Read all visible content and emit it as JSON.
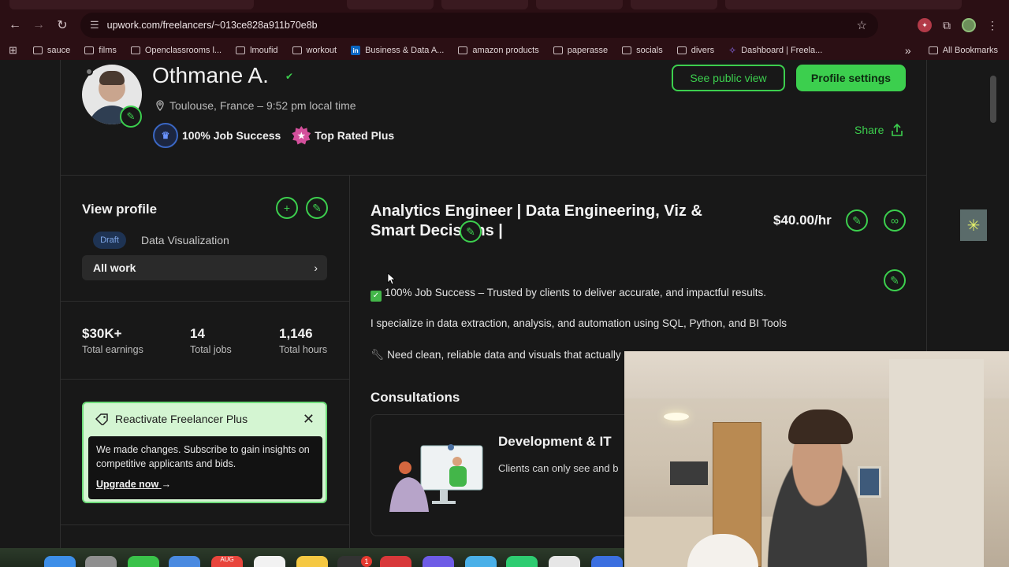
{
  "browser": {
    "url": "upwork.com/freelancers/~013ce828a911b70e8b",
    "bookmarks": [
      {
        "label": "sauce",
        "icon": "folder"
      },
      {
        "label": "films",
        "icon": "folder"
      },
      {
        "label": "Openclassrooms l...",
        "icon": "folder"
      },
      {
        "label": "lmoufid",
        "icon": "folder"
      },
      {
        "label": "workout",
        "icon": "folder"
      },
      {
        "label": "Business & Data A...",
        "icon": "linkedin"
      },
      {
        "label": "amazon products",
        "icon": "folder"
      },
      {
        "label": "paperasse",
        "icon": "folder"
      },
      {
        "label": "socials",
        "icon": "folder"
      },
      {
        "label": "divers",
        "icon": "folder"
      },
      {
        "label": "Dashboard | Freela...",
        "icon": "upwork"
      }
    ],
    "overflow_label": "»",
    "all_bookmarks_label": "All Bookmarks"
  },
  "profile": {
    "name": "Othmane A.",
    "location": "Toulouse, France – 9:52 pm local time",
    "job_success": "100% Job Success",
    "top_rated": "Top Rated Plus",
    "see_public_view": "See public view",
    "profile_settings": "Profile settings",
    "share": "Share"
  },
  "left": {
    "view_profile": "View profile",
    "draft": "Draft",
    "data_visualization": "Data Visualization",
    "all_work": "All work",
    "stats": [
      {
        "value": "$30K+",
        "label": "Total earnings"
      },
      {
        "value": "14",
        "label": "Total jobs"
      },
      {
        "value": "1,146",
        "label": "Total hours"
      }
    ],
    "promo": {
      "title": "Reactivate Freelancer Plus",
      "body": "We made changes. Subscribe to gain insights on competitive applicants and bids.",
      "link": "Upgrade now"
    }
  },
  "right": {
    "headline": "Analytics Engineer | Data Engineering, Viz & Smart Decisions |",
    "rate": "$40.00/hr",
    "line1": "100% Job Success – Trusted by clients to deliver accurate, and impactful results.",
    "line2": "I specialize in data extraction, analysis, and automation using SQL, Python, and BI Tools",
    "line3": "Need clean, reliable data and visuals that actually",
    "consultations": "Consultations",
    "dev_title": "Development & IT",
    "dev_sub": "Clients can only see and b"
  },
  "dock": {
    "badge": "1",
    "calendar_month": "AUG"
  },
  "colors": {
    "accent": "#3ccf4e",
    "chrome": "#2b0f14",
    "page": "#181818"
  }
}
